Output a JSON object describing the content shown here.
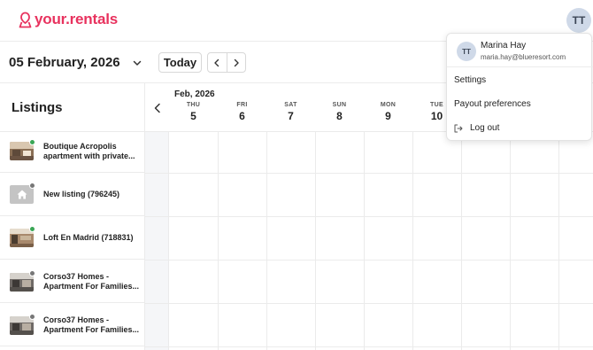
{
  "brand": {
    "logo_text": "your.rentals",
    "accent": "#e8325e"
  },
  "header": {
    "avatar_initials": "TT"
  },
  "toolbar": {
    "date_title": "05 February, 2026",
    "today_label": "Today",
    "date_chevron_icon": "chevron-down-icon",
    "prev_icon": "chevron-left-icon",
    "next_icon": "chevron-right-icon"
  },
  "listings": {
    "title": "Listings",
    "items": [
      {
        "name": "Boutique Acropolis apartment with private...",
        "status_color": "#3aa655",
        "thumb": "photo"
      },
      {
        "name": "New listing (796245)",
        "status_color": "#777777",
        "thumb": "home-icon"
      },
      {
        "name": "Loft En Madrid (718831)",
        "status_color": "#3aa655",
        "thumb": "photo"
      },
      {
        "name": "Corso37 Homes - Apartment For Families...",
        "status_color": "#777777",
        "thumb": "photo"
      },
      {
        "name": "Corso37 Homes - Apartment For Families...",
        "status_color": "#777777",
        "thumb": "photo"
      }
    ]
  },
  "calendar": {
    "month_label": "Feb, 2026",
    "days": [
      {
        "dow": "THU",
        "num": "5"
      },
      {
        "dow": "FRI",
        "num": "6"
      },
      {
        "dow": "SAT",
        "num": "7"
      },
      {
        "dow": "SUN",
        "num": "8"
      },
      {
        "dow": "MON",
        "num": "9"
      },
      {
        "dow": "TUE",
        "num": "10"
      }
    ]
  },
  "user_menu": {
    "avatar_initials": "TT",
    "name": "Marina Hay",
    "email": "maria.hay@blueresort.com",
    "items": [
      "Settings",
      "Payout preferences"
    ],
    "logout_label": "Log out",
    "logout_icon": "logout-icon"
  }
}
